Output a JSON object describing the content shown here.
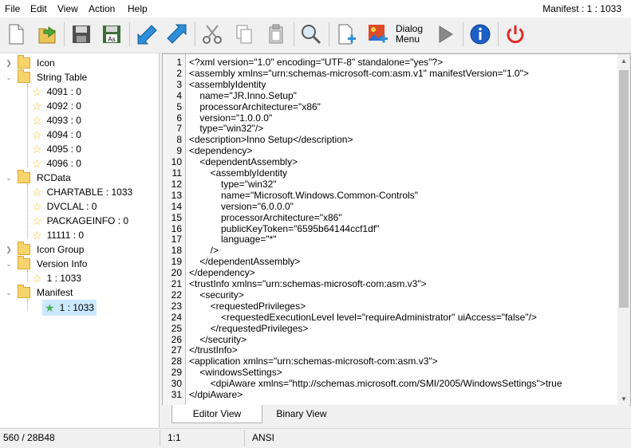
{
  "menu": {
    "items": [
      "File",
      "Edit",
      "View",
      "Action",
      "Help"
    ],
    "title_right": "Manifest : 1 : 1033"
  },
  "toolbar": {
    "dialog_menu_label_1": "Dialog",
    "dialog_menu_label_2": "Menu"
  },
  "tree": {
    "nodes": [
      {
        "label": "Icon"
      },
      {
        "label": "String Table"
      },
      {
        "label": "4091 : 0"
      },
      {
        "label": "4092 : 0"
      },
      {
        "label": "4093 : 0"
      },
      {
        "label": "4094 : 0"
      },
      {
        "label": "4095 : 0"
      },
      {
        "label": "4096 : 0"
      },
      {
        "label": "RCData"
      },
      {
        "label": "CHARTABLE : 1033"
      },
      {
        "label": "DVCLAL : 0"
      },
      {
        "label": "PACKAGEINFO : 0"
      },
      {
        "label": "11111 : 0"
      },
      {
        "label": "Icon Group"
      },
      {
        "label": "Version Info"
      },
      {
        "label": "1 : 1033"
      },
      {
        "label": "Manifest"
      },
      {
        "label": "1 : 1033"
      }
    ]
  },
  "editor": {
    "lines": [
      "<?xml version=\"1.0\" encoding=\"UTF-8\" standalone=\"yes\"?>",
      "<assembly xmlns=\"urn:schemas-microsoft-com:asm.v1\" manifestVersion=\"1.0\">",
      "<assemblyIdentity",
      "    name=\"JR.Inno.Setup\"",
      "    processorArchitecture=\"x86\"",
      "    version=\"1.0.0.0\"",
      "    type=\"win32\"/>",
      "<description>Inno Setup</description>",
      "<dependency>",
      "    <dependentAssembly>",
      "        <assemblyIdentity",
      "            type=\"win32\"",
      "            name=\"Microsoft.Windows.Common-Controls\"",
      "            version=\"6.0.0.0\"",
      "            processorArchitecture=\"x86\"",
      "            publicKeyToken=\"6595b64144ccf1df\"",
      "            language=\"*\"",
      "        />",
      "    </dependentAssembly>",
      "</dependency>",
      "<trustInfo xmlns=\"urn:schemas-microsoft-com:asm.v3\">",
      "    <security>",
      "        <requestedPrivileges>",
      "            <requestedExecutionLevel level=\"requireAdministrator\" uiAccess=\"false\"/>",
      "        </requestedPrivileges>",
      "    </security>",
      "</trustInfo>",
      "<application xmlns=\"urn:schemas-microsoft-com:asm.v3\">",
      "    <windowsSettings>",
      "        <dpiAware xmlns=\"http://schemas.microsoft.com/SMI/2005/WindowsSettings\">true",
      "</dpiAware>"
    ]
  },
  "tabs": {
    "editor_view": "Editor View",
    "binary_view": "Binary View"
  },
  "status": {
    "size": "560 / 28B48",
    "position": "1:1",
    "encoding": "ANSI"
  }
}
